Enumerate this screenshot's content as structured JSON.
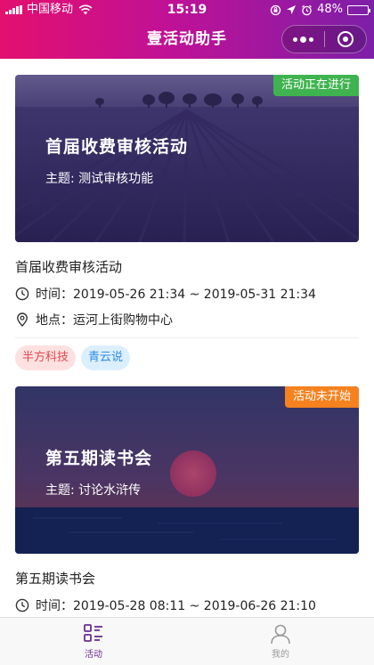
{
  "status_bar": {
    "carrier": "中国移动",
    "time": "15:19",
    "battery": "48%",
    "battery_level": 0.48
  },
  "nav": {
    "title": "壹活动助手",
    "more_icon": "more-dots-icon",
    "close_icon": "target-circle-icon"
  },
  "colors": {
    "header_gradient": [
      "#e3106e",
      "#c01196",
      "#7d1fa8"
    ],
    "tag_running": "#3fb34f",
    "tag_pending": "#f5821f",
    "tab_active": "#6a2c91",
    "tab_inactive": "#999999"
  },
  "activities": [
    {
      "cover_title": "首届收费审核活动",
      "cover_subtitle": "主题: 测试审核功能",
      "status": "活动正在进行",
      "status_color": "#3fb34f",
      "title": "首届收费审核活动",
      "time": "时间：2019-05-26 21:34 ~ 2019-05-31 21:34",
      "location": "地点：运河上街购物中心",
      "tags": [
        {
          "label": "半方科技",
          "bg": "#fde1e1",
          "fg": "#e5484d"
        },
        {
          "label": "青云说",
          "bg": "#dcefff",
          "fg": "#2f8ee5"
        }
      ]
    },
    {
      "cover_title": "第五期读书会",
      "cover_subtitle": "主题: 讨论水浒传",
      "status": "活动未开始",
      "status_color": "#f5821f",
      "title": "第五期读书会",
      "time": "时间：2019-05-28 08:11 ~ 2019-06-26 21:10"
    }
  ],
  "tabbar": {
    "items": [
      {
        "label": "活动",
        "icon": "activity-list-icon",
        "active": true
      },
      {
        "label": "我的",
        "icon": "user-profile-icon",
        "active": false
      }
    ]
  }
}
